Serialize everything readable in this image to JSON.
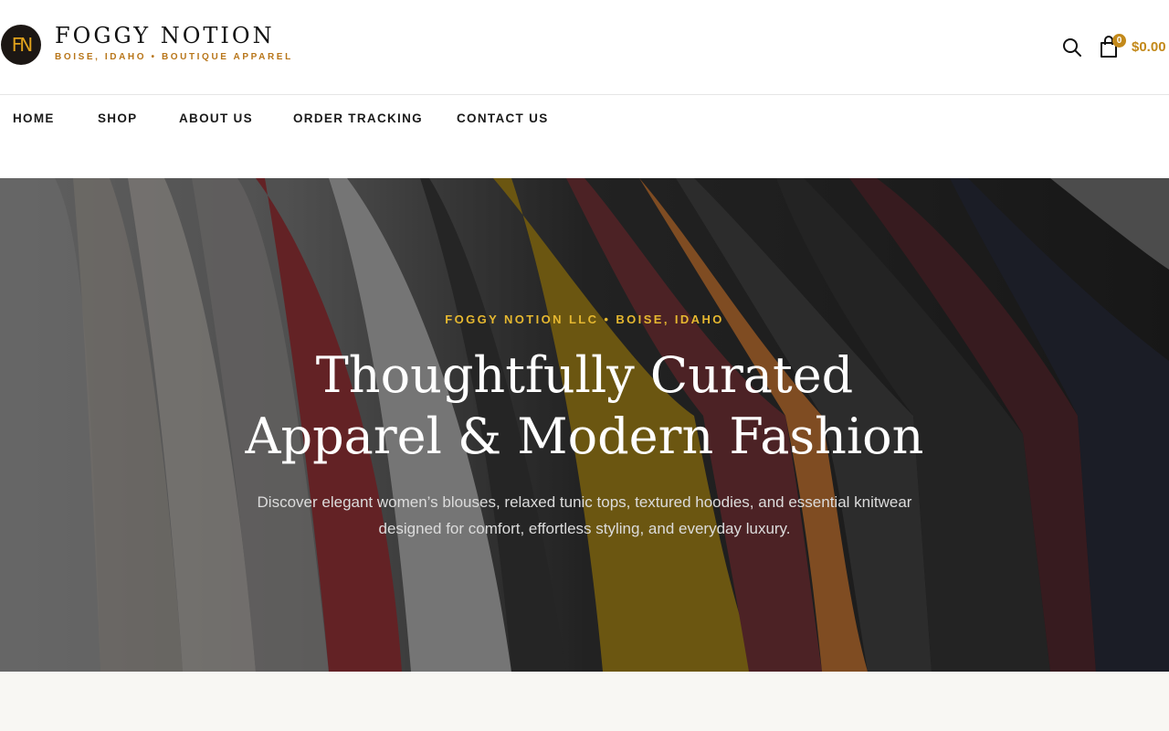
{
  "brand": {
    "logo_initials": "FN",
    "name": "FOGGY NOTION",
    "tagline": "BOISE, IDAHO • BOUTIQUE APPAREL"
  },
  "header": {
    "cart_count": "0",
    "cart_total": "$0.00"
  },
  "nav": {
    "items": [
      {
        "label": "HOME"
      },
      {
        "label": "SHOP"
      },
      {
        "label": "ABOUT US"
      },
      {
        "label": "ORDER TRACKING"
      },
      {
        "label": "CONTACT US"
      }
    ]
  },
  "hero": {
    "eyebrow": "FOGGY NOTION LLC • BOISE, IDAHO",
    "title": "Thoughtfully Curated Apparel & Modern Fashion",
    "description": "Discover elegant women’s blouses, relaxed tunic tops, textured hoodies, and essential knitwear designed for comfort, effortless styling, and everyday luxury."
  },
  "colors": {
    "accent": "#c3891a",
    "eyebrow": "#e6b830",
    "logo_bg": "#1c1714"
  }
}
